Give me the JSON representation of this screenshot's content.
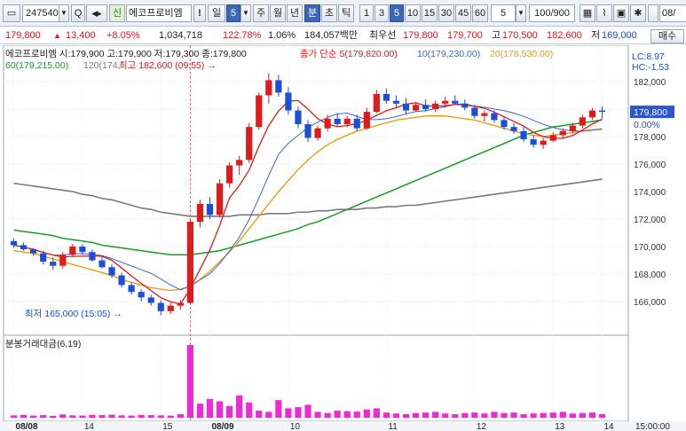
{
  "toolbar": {
    "code": "247540",
    "market_badge": "신",
    "stock_name": "에코프로비엠",
    "warn_badge": "!",
    "period_buttons": [
      "일",
      "주",
      "월",
      "년",
      "분",
      "초",
      "틱"
    ],
    "period_value": "5",
    "minute_buttons": [
      "1",
      "3",
      "5",
      "10",
      "15",
      "30",
      "45",
      "60"
    ],
    "interval_value": "5",
    "count_display": "100/900",
    "date_label": "08/"
  },
  "quote": {
    "price": "179,800",
    "change": "13,400",
    "change_pct": "+8.05%",
    "volume": "1,034,718",
    "volume_ratio": "122.78%",
    "turnover": "1.06%",
    "amount": "184,057백만",
    "best_bid_label": "최우선",
    "ask": "179,800",
    "bid": "179,700",
    "high_label": "고",
    "high": "170,500",
    "high2": "182,600",
    "low_label": "저",
    "low": "169,000",
    "action": "매수"
  },
  "chart_data": {
    "type": "candlestick",
    "title": "에코프로비엠",
    "info_line": "에코프로비엠 시:179,900 고:179,900 저:179,300 종:179,800",
    "ma_legend": [
      {
        "label": "종가 단순 5(179,820.00)",
        "color": "#e01b1b"
      },
      {
        "label": "10(179,230.00)",
        "color": "#3b66d8"
      },
      {
        "label": "20(178,530.00)",
        "color": "#e3a118"
      },
      {
        "label": "60(179,215.00)",
        "color": "#1b9a2c"
      },
      {
        "label": "120(174,",
        "color": "#7a7a7a"
      }
    ],
    "high_annot": "최고 182,600 (09:55)",
    "low_annot": "최저 165,000 (15:05)",
    "right_labels": {
      "lc": "LC:8.97",
      "hc": "HC:-1.53"
    },
    "current_price": "179,800",
    "current_pct": "0.00%",
    "ylim": [
      164000,
      184000
    ],
    "y_ticks": [
      "166,000",
      "168,000",
      "170,000",
      "172,000",
      "174,000",
      "176,000",
      "178,000",
      "180,000",
      "182,000"
    ],
    "x_ticks": [
      "08/08",
      "14",
      "15",
      "08/09",
      "10",
      "11",
      "12",
      "13",
      "14"
    ],
    "x_last_label": "15:00:00",
    "candles": [
      [
        170400,
        170600,
        169900,
        170100
      ],
      [
        170100,
        170300,
        169700,
        169800
      ],
      [
        169800,
        169900,
        169300,
        169500
      ],
      [
        169500,
        169700,
        168700,
        168900
      ],
      [
        168900,
        169200,
        168300,
        168600
      ],
      [
        168600,
        169600,
        168400,
        169400
      ],
      [
        169400,
        170200,
        169300,
        170000
      ],
      [
        170000,
        170200,
        169400,
        169600
      ],
      [
        169600,
        169800,
        168900,
        169000
      ],
      [
        169000,
        169300,
        168400,
        168500
      ],
      [
        168500,
        168700,
        167700,
        167900
      ],
      [
        167900,
        168100,
        167000,
        167200
      ],
      [
        167200,
        167400,
        166500,
        166700
      ],
      [
        166700,
        166900,
        166000,
        166300
      ],
      [
        166300,
        166500,
        165700,
        165900
      ],
      [
        165900,
        166100,
        165000,
        165300
      ],
      [
        165300,
        165900,
        165100,
        165700
      ],
      [
        165700,
        166100,
        165400,
        165900
      ],
      [
        165900,
        172000,
        165800,
        171800
      ],
      [
        171800,
        173400,
        171400,
        173100
      ],
      [
        173100,
        173600,
        172000,
        172300
      ],
      [
        172300,
        174900,
        172100,
        174600
      ],
      [
        174600,
        176100,
        174300,
        175900
      ],
      [
        175900,
        176600,
        175200,
        176300
      ],
      [
        176300,
        179000,
        176100,
        178700
      ],
      [
        178700,
        181200,
        178500,
        181000
      ],
      [
        181000,
        182600,
        180400,
        182100
      ],
      [
        182100,
        182500,
        180900,
        181200
      ],
      [
        181200,
        181600,
        179600,
        179900
      ],
      [
        179900,
        180200,
        178600,
        178900
      ],
      [
        178900,
        179200,
        177600,
        177900
      ],
      [
        177900,
        178800,
        177700,
        178600
      ],
      [
        178600,
        179600,
        178400,
        179300
      ],
      [
        179300,
        179700,
        178700,
        178900
      ],
      [
        178900,
        179500,
        178700,
        179300
      ],
      [
        179300,
        179600,
        178400,
        178600
      ],
      [
        178600,
        180100,
        178500,
        179800
      ],
      [
        179800,
        181400,
        179700,
        181100
      ],
      [
        181100,
        181500,
        180400,
        180600
      ],
      [
        180600,
        181000,
        180100,
        180400
      ],
      [
        180400,
        180800,
        179600,
        179900
      ],
      [
        179900,
        180500,
        179800,
        180300
      ],
      [
        180300,
        180700,
        179800,
        180000
      ],
      [
        180000,
        180600,
        179800,
        180400
      ],
      [
        180400,
        180900,
        180100,
        180600
      ],
      [
        180600,
        181000,
        180300,
        180400
      ],
      [
        180400,
        180700,
        179900,
        180100
      ],
      [
        180100,
        180300,
        179300,
        179500
      ],
      [
        179500,
        179900,
        179100,
        179700
      ],
      [
        179700,
        179900,
        179000,
        179200
      ],
      [
        179200,
        179500,
        178500,
        178700
      ],
      [
        178700,
        179000,
        178200,
        178400
      ],
      [
        178400,
        178700,
        177600,
        177800
      ],
      [
        177800,
        178100,
        177200,
        177400
      ],
      [
        177400,
        177900,
        177100,
        177700
      ],
      [
        177700,
        178300,
        177600,
        178100
      ],
      [
        178100,
        178600,
        177900,
        178400
      ],
      [
        178400,
        179000,
        178200,
        178800
      ],
      [
        178800,
        179600,
        178600,
        179400
      ],
      [
        179400,
        180100,
        179200,
        179900
      ],
      [
        179900,
        180200,
        179300,
        179800
      ]
    ],
    "ma20": [
      169700,
      169600,
      169500,
      169300,
      169100,
      168900,
      168700,
      168500,
      168300,
      168100,
      167900,
      167600,
      167400,
      167200,
      167000,
      166900,
      166800,
      166900,
      167100,
      167600,
      168200,
      168900,
      169600,
      170400,
      171300,
      172200,
      173100,
      174000,
      174800,
      175600,
      176300,
      176900,
      177400,
      177800,
      178100,
      178400,
      178600,
      178800,
      179000,
      179200,
      179300,
      179400,
      179500,
      179500,
      179500,
      179400,
      179300,
      179200,
      179000,
      178800,
      178600,
      178400,
      178200,
      178100,
      178000,
      178100,
      178200,
      178300,
      178400,
      178500,
      178530
    ],
    "ma60": [
      171200,
      171100,
      171000,
      170900,
      170800,
      170600,
      170500,
      170400,
      170300,
      170100,
      170000,
      169900,
      169800,
      169700,
      169600,
      169500,
      169400,
      169400,
      169400,
      169500,
      169600,
      169700,
      169900,
      170100,
      170300,
      170500,
      170700,
      170900,
      171100,
      171300,
      171600,
      171800,
      172100,
      172400,
      172700,
      173000,
      173300,
      173600,
      173900,
      174200,
      174500,
      174800,
      175100,
      175400,
      175700,
      176000,
      176300,
      176600,
      176900,
      177200,
      177500,
      177800,
      178100,
      178300,
      178500,
      178700,
      178800,
      178900,
      179000,
      179100,
      179215
    ],
    "ma120": [
      174600,
      174500,
      174400,
      174300,
      174200,
      174100,
      174000,
      173800,
      173700,
      173500,
      173400,
      173200,
      173000,
      172800,
      172700,
      172500,
      172400,
      172300,
      172200,
      172200,
      172200,
      172200,
      172200,
      172300,
      172300,
      172300,
      172400,
      172400,
      172400,
      172500,
      172500,
      172600,
      172600,
      172700,
      172700,
      172700,
      172800,
      172800,
      172900,
      172900,
      173000,
      173000,
      173100,
      173200,
      173300,
      173400,
      173500,
      173600,
      173700,
      173800,
      173900,
      174000,
      174100,
      174200,
      174300,
      174400,
      174500,
      174600,
      174700,
      174800,
      174900
    ],
    "volume_title": "분봉거래대금(6,19)",
    "volume_ticks": [
      "100,00",
      "200,00",
      "300,00"
    ],
    "volume_max": 340,
    "volume": [
      10,
      12,
      9,
      11,
      8,
      14,
      10,
      9,
      12,
      11,
      13,
      10,
      9,
      12,
      11,
      10,
      9,
      15,
      310,
      60,
      80,
      70,
      50,
      95,
      65,
      30,
      25,
      75,
      40,
      45,
      55,
      25,
      20,
      30,
      28,
      26,
      35,
      40,
      22,
      18,
      15,
      20,
      22,
      25,
      18,
      15,
      20,
      22,
      18,
      25,
      20,
      22,
      15,
      18,
      20,
      22,
      25,
      18,
      20,
      22,
      15
    ]
  }
}
